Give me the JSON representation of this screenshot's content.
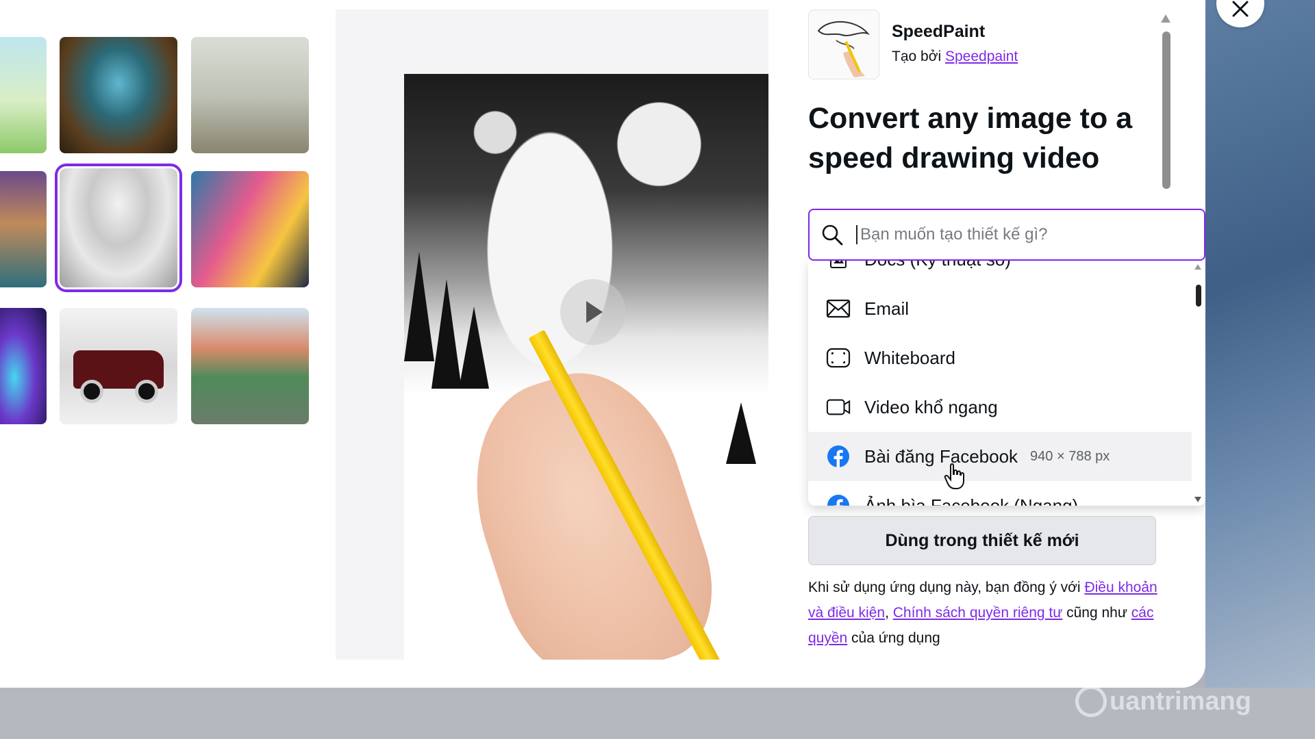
{
  "app": {
    "name": "SpeedPaint",
    "by_prefix": "Tạo bởi",
    "by_link": "Speedpaint",
    "headline": "Convert any image to a speed drawing video"
  },
  "search": {
    "placeholder": "Bạn muốn tạo thiết kế gì?"
  },
  "dropdown": {
    "items": [
      {
        "label": "Docs (Kỹ thuật số)",
        "icon": "doc-icon",
        "dim": ""
      },
      {
        "label": "Email",
        "icon": "email-icon",
        "dim": ""
      },
      {
        "label": "Whiteboard",
        "icon": "whiteboard-icon",
        "dim": ""
      },
      {
        "label": "Video khổ ngang",
        "icon": "video-icon",
        "dim": ""
      },
      {
        "label": "Bài đăng Facebook",
        "icon": "facebook-icon",
        "dim": "940 × 788 px"
      },
      {
        "label": "Ảnh bìa Facebook (Ngang)",
        "icon": "facebook-icon",
        "dim": ""
      }
    ]
  },
  "buttons": {
    "use_in_new_design": "Dùng trong thiết kế mới"
  },
  "terms": {
    "prefix": "Khi sử dụng ứng dụng này, bạn đồng ý với ",
    "link1": "Điều khoản và điều kiện",
    "sep": ", ",
    "link2": "Chính sách quyền riêng tư",
    "middle": " cũng như ",
    "link3": "các quyền",
    "suffix": " của ứng dụng"
  },
  "watermark": "uantrimang",
  "colors": {
    "accent": "#7d2ae8",
    "facebook": "#1877f2"
  }
}
